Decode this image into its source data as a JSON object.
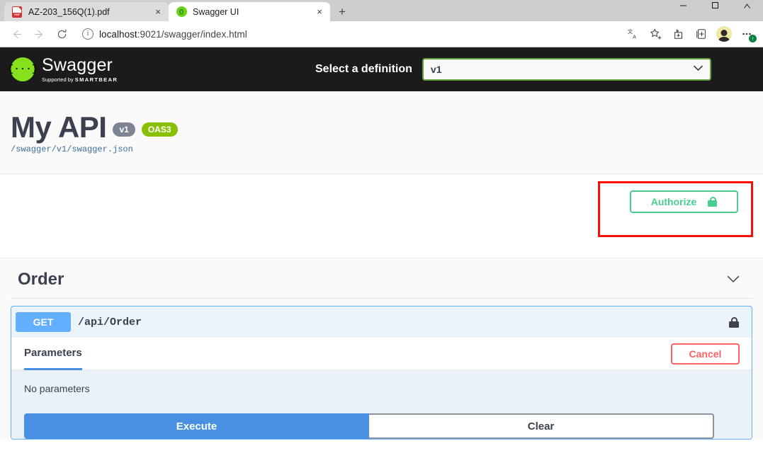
{
  "browser": {
    "tabs": [
      {
        "title": "AZ-203_156Q(1).pdf",
        "favicon": "pdf-icon",
        "active": false,
        "close_label": "×"
      },
      {
        "title": "Swagger UI",
        "favicon": "swagger-favicon",
        "active": true,
        "close_label": "×"
      }
    ],
    "new_tab_label": "+",
    "window_controls": {
      "minimize": "minimize",
      "maximize": "maximize",
      "close": "close"
    },
    "nav": {
      "back": "back-arrow",
      "forward": "forward-arrow",
      "reload": "reload-arrow"
    },
    "address": {
      "info_icon": "ⓘ",
      "url_host": "localhost",
      "url_rest": ":9021/swagger/index.html",
      "url_full": "localhost:9021/swagger/index.html"
    },
    "toolbar_icons": [
      "translate-icon",
      "favorite-star-icon",
      "collections-icon",
      "browser-essentials-icon",
      "profile-avatar-icon",
      "settings-more-icon"
    ],
    "update_badge": "↑"
  },
  "topbar": {
    "logo_mark": "{···}",
    "logo_name": "Swagger",
    "logo_sub_prefix": "Supported by ",
    "logo_sub_brand": "SMARTBEAR",
    "definition_label": "Select a definition",
    "definition_value": "v1",
    "definition_chevron": "⌄"
  },
  "info": {
    "title": "My API",
    "version_badge": "v1",
    "oas_badge": "OAS3",
    "spec_url": "/swagger/v1/swagger.json"
  },
  "authorize": {
    "label": "Authorize",
    "icon": "lock-open-icon",
    "highlight_color": "#f90f07",
    "accent_color": "#49cc90"
  },
  "tag": {
    "name": "Order",
    "collapse_chevron": "⌄"
  },
  "operation": {
    "method": "GET",
    "path": "/api/Order",
    "method_color": "#61affe",
    "lock_icon": "lock-open-icon",
    "tabs": [
      {
        "label": "Parameters",
        "active": true
      }
    ],
    "cancel_label": "Cancel",
    "no_parameters_text": "No parameters",
    "execute_label": "Execute",
    "clear_label": "Clear"
  }
}
